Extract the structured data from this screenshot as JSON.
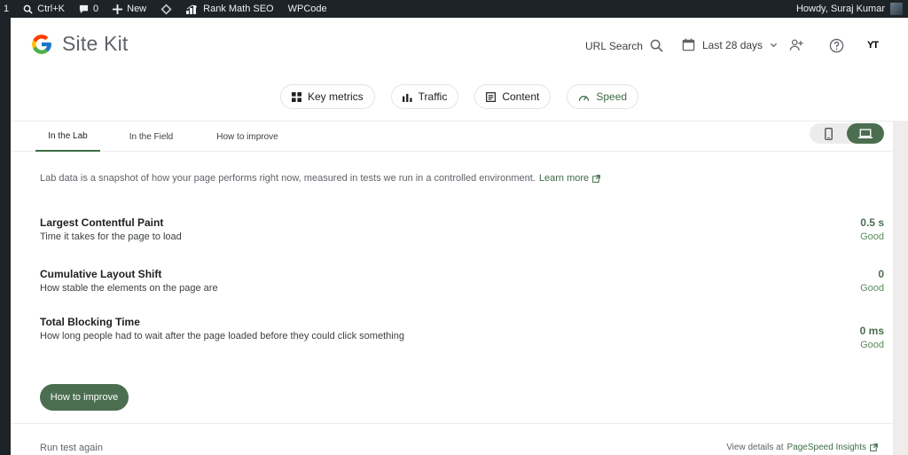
{
  "admin_bar": {
    "count": "1",
    "search_shortcut": "Ctrl+K",
    "comments": "0",
    "new_label": "New",
    "rank_math": "Rank Math SEO",
    "wpcode": "WPCode",
    "howdy": "Howdy, Suraj Kumar"
  },
  "header": {
    "logo_text": "Site Kit",
    "url_search": "URL Search",
    "date_range": "Last 28 days",
    "avatar_label": "YT"
  },
  "nav": {
    "items": [
      {
        "label": "Key metrics",
        "icon": "grid-icon"
      },
      {
        "label": "Traffic",
        "icon": "bar-chart-icon"
      },
      {
        "label": "Content",
        "icon": "list-icon"
      },
      {
        "label": "Speed",
        "icon": "speedometer-icon",
        "active": true
      }
    ]
  },
  "tabs": [
    {
      "label": "In the Lab",
      "active": true
    },
    {
      "label": "In the Field"
    },
    {
      "label": "How to improve"
    }
  ],
  "device_toggle": {
    "options": [
      "mobile",
      "desktop"
    ],
    "selected": "desktop"
  },
  "intro": {
    "text": "Lab data is a snapshot of how your page performs right now, measured in tests we run in a controlled environment.",
    "learn_more": "Learn more"
  },
  "metrics": [
    {
      "title": "Largest Contentful Paint",
      "description": "Time it takes for the page to load",
      "value": "0.5 s",
      "status": "Good"
    },
    {
      "title": "Cumulative Layout Shift",
      "description": "How stable the elements on the page are",
      "value": "0",
      "status": "Good"
    },
    {
      "title": "Total Blocking Time",
      "description": "How long people had to wait after the page loaded before they could click something",
      "value": "0 ms",
      "status": "Good"
    }
  ],
  "improve_button": "How to improve",
  "footer": {
    "run_again": "Run test again",
    "view_details_prefix": "View details at",
    "view_details_link": "PageSpeed Insights"
  },
  "colors": {
    "accent": "#4b6e50",
    "admin_bar": "#1d2327",
    "background": "#f1ecec"
  }
}
